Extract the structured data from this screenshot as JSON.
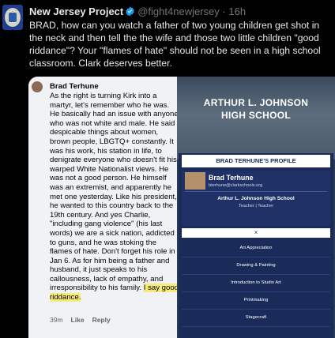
{
  "tweet": {
    "author_name": "New Jersey Project",
    "handle": "@fight4newjersey",
    "separator": "·",
    "time": "16h",
    "text": "BRAD, how can you watch a father of two young children get shot in the neck and then tell the the wife and those two little children \"good riddance\"?   Your \"flames of hate\" should not be seen in a high school classroom. Clark deserves better."
  },
  "comment": {
    "author": "Brad Terhune",
    "text_main": "As the right is turning Kirk into a martyr, let's remember who he was. He basically had an issue with anyone who was not white and male. He said despicable things about women, brown people, LBGTQ+ constantly. It was his work, his station in life, to denigrate everyone who doesn't fit his warped White Nationalist views. He was not a good person. He himself was an extremist, and apparently he met one yesterday. Like his president, he wanted to this country back to the 19th century. And yes Charlie, \"including gang violence\" (his last words) we are a sick nation, addicted to guns, and he was stoking the flames of hate. Don't forget his role in Jan 6. As for him being a father and husband, it just speaks to his callousness, lack of empathy, and irresponsibility to his family.",
    "text_highlight": "I say good riddance.",
    "time": "39m",
    "like": "Like",
    "reply": "Reply"
  },
  "profile": {
    "banner_line1": "ARTHUR L. JOHNSON",
    "banner_line2": "HIGH SCHOOL",
    "section_title": "BRAD TERHUNE'S PROFILE",
    "name": "Brad Terhune",
    "email": "bterhune@clarkschools.org",
    "school": "Arthur L. Johnson High School",
    "role": "Teacher  |  Teacher",
    "close": "×",
    "menu": [
      "Art Appreciation",
      "Drawing & Painting",
      "Introduction to Studio Art",
      "Printmaking",
      "Stagecraft"
    ]
  },
  "colors": {
    "verified": "#1d9bf0",
    "highlight": "#f5ea7a",
    "profile_navy": "#1a2b5a"
  }
}
